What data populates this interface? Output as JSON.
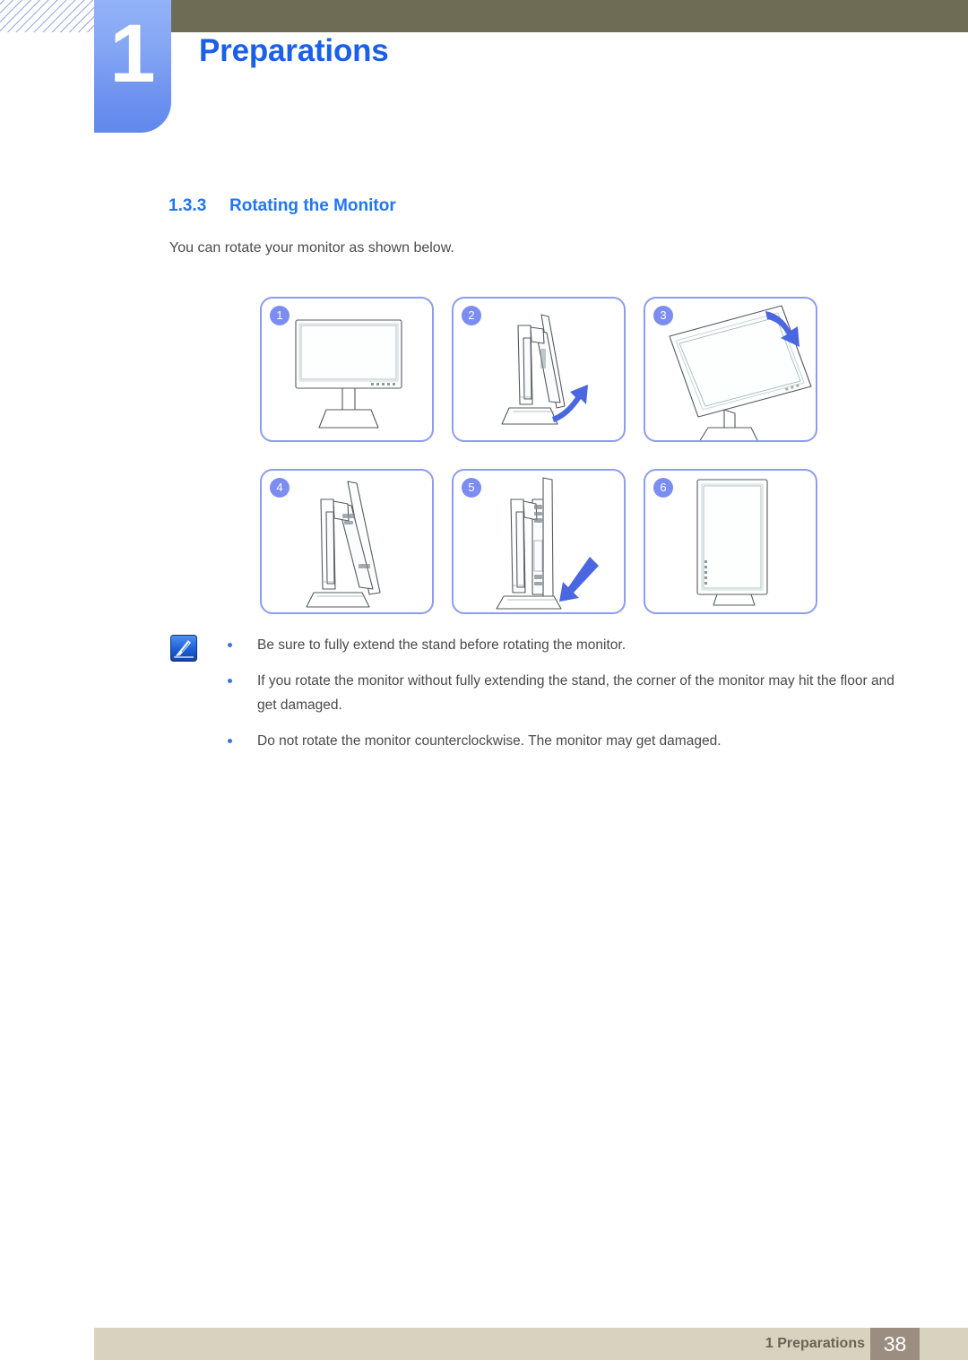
{
  "header": {
    "chapter_number": "1",
    "chapter_title": "Preparations",
    "hatch_icon": "diagonal-hatch-decoration",
    "bar_color": "#6e6c54",
    "tab_color": "#84a6f3",
    "title_color": "#1b60e8"
  },
  "section": {
    "number": "1.3.3",
    "title": "Rotating the Monitor",
    "intro": "You can rotate your monitor as shown below.",
    "heading_color": "#2176f0"
  },
  "steps": [
    {
      "badge": "1",
      "caption": "monitor-landscape-front-view"
    },
    {
      "badge": "2",
      "caption": "monitor-side-view-tilt-up-arrow"
    },
    {
      "badge": "3",
      "caption": "monitor-rotating-clockwise-arrow"
    },
    {
      "badge": "4",
      "caption": "monitor-side-view-portrait-tilted"
    },
    {
      "badge": "5",
      "caption": "monitor-side-view-portrait-down-arrow"
    },
    {
      "badge": "6",
      "caption": "monitor-portrait-front-view"
    }
  ],
  "note": {
    "icon": "note-pen-icon",
    "accent_color": "#2f6bd0",
    "items": [
      "Be sure to fully extend the stand before rotating the monitor.",
      "If you rotate the monitor without fully extending the stand, the corner of the monitor may hit the floor and get damaged.",
      "Do not rotate the monitor counterclockwise. The monitor may get damaged."
    ]
  },
  "footer": {
    "label": "1 Preparations",
    "page_number": "38",
    "bar_color": "#d8d2bf",
    "page_box_color": "#9b8e80"
  }
}
